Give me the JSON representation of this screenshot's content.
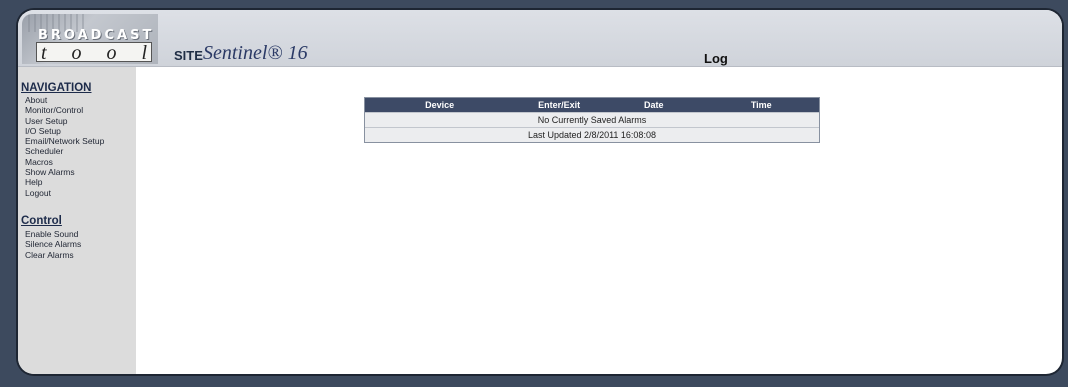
{
  "header": {
    "logo_top": "BROADCAST",
    "logo_bottom": "t o o l s",
    "site_label": "SITE",
    "product_name": "Sentinel® 16",
    "page_title": "Log"
  },
  "navigation": {
    "heading": "NAVIGATION",
    "items": [
      {
        "label": "About"
      },
      {
        "label": "Monitor/Control"
      },
      {
        "label": "User Setup"
      },
      {
        "label": "I/O Setup"
      },
      {
        "label": "Email/Network Setup"
      },
      {
        "label": "Scheduler"
      },
      {
        "label": "Macros"
      },
      {
        "label": "Show Alarms"
      },
      {
        "label": "Help"
      },
      {
        "label": "Logout"
      }
    ]
  },
  "control": {
    "heading": "Control",
    "items": [
      {
        "label": "Enable Sound"
      },
      {
        "label": "Silence Alarms"
      },
      {
        "label": "Clear Alarms"
      }
    ]
  },
  "log_table": {
    "columns": [
      "Device",
      "Enter/Exit",
      "Date",
      "Time"
    ],
    "empty_message": "No Currently Saved Alarms",
    "last_updated": "Last Updated 2/8/2011 16:08:08"
  },
  "colors": {
    "table_header": "#3d4a66",
    "sidebar": "#dcdcdc",
    "page_background": "#3d4a5e"
  }
}
